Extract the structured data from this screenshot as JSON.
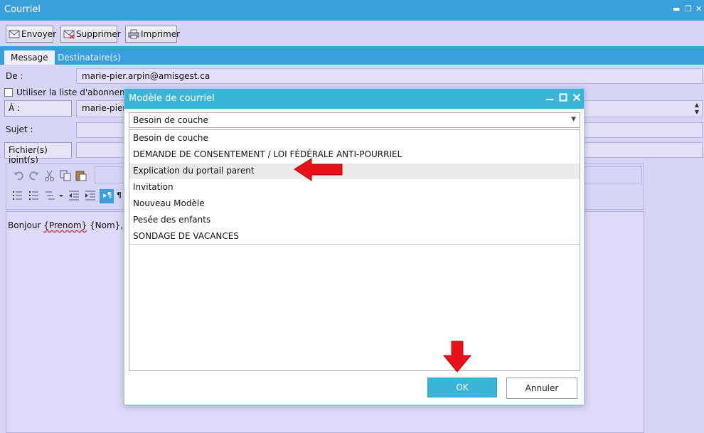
{
  "window": {
    "title": "Courriel",
    "controls": [
      "▬",
      "❐",
      "✕"
    ]
  },
  "toolbar": {
    "send_label": "Envoyer",
    "delete_label": "Supprimer",
    "print_label": "Imprimer"
  },
  "tabs": [
    {
      "label": "Message",
      "active": true
    },
    {
      "label": "Destinataire(s)",
      "active": false
    }
  ],
  "form": {
    "from_label": "De :",
    "from_value": "marie-pier.arpin@amisgest.ca",
    "subscription_label": "Utiliser la liste d'abonnemen",
    "to_button": "À :",
    "to_value": "marie-pier.",
    "subject_label": "Sujet :",
    "attachments_button": "Fichier(s) joint(s)"
  },
  "editor": {
    "body_greeting": "Bonjour ",
    "body_prenom": "{Prenom}",
    "body_nom": " {Nom},",
    "pilcrow": "¶"
  },
  "dialog": {
    "title": "Modèle de courriel",
    "selected_value": "Besoin de couche",
    "items": [
      "Besoin de couche",
      "DEMANDE DE CONSENTEMENT / LOI FÉDÉRALE ANTI-POURRIEL",
      "Explication du portail parent",
      "Invitation",
      "Nouveau Modèle",
      "Pesée des enfants",
      "SONDAGE DE VACANCES"
    ],
    "highlighted_index": 2,
    "ok_label": "OK",
    "cancel_label": "Annuler"
  },
  "colors": {
    "titlebar": "#3aa0dc",
    "dialog_title": "#3ab5d8",
    "background": "#d7d5f6",
    "arrow": "#e8101a"
  }
}
